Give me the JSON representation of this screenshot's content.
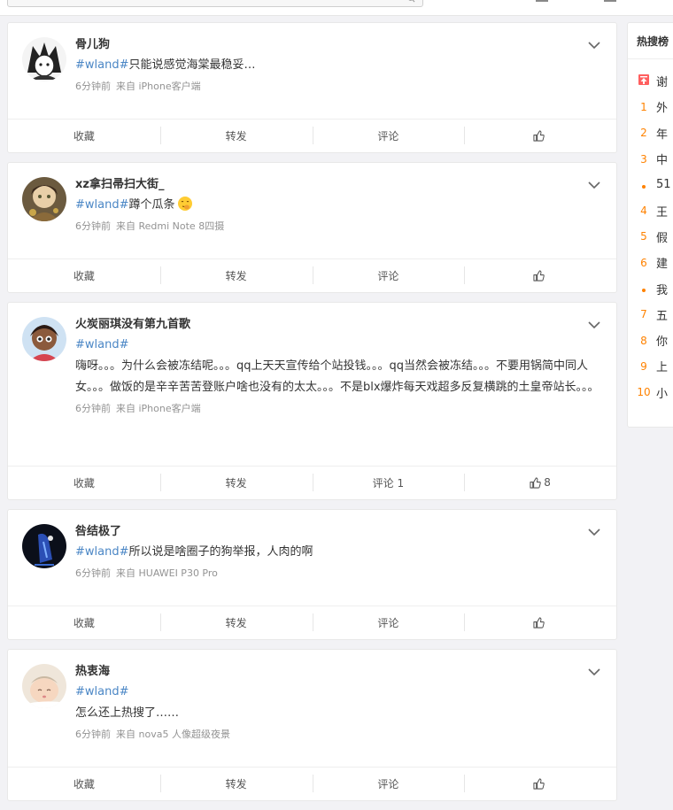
{
  "posts": [
    {
      "username": "骨儿狗",
      "topic": "#wland#",
      "text": "只能说感觉海棠最稳妥…",
      "time": "6分钟前",
      "source": "来自 iPhone客户端",
      "actions": {
        "collect": "收藏",
        "repost": "转发",
        "comment": "评论",
        "like_count": ""
      }
    },
    {
      "username": "xz拿扫帚扫大街_",
      "topic": "#wland#",
      "text": "蹲个瓜条",
      "time": "6分钟前",
      "source": "来自 Redmi Note 8四摄",
      "actions": {
        "collect": "收藏",
        "repost": "转发",
        "comment": "评论",
        "like_count": ""
      }
    },
    {
      "username": "火炭丽琪没有第九首歌",
      "topic": "#wland#",
      "text": "嗨呀。。。为什么会被冻结呢。。。qq上天天宣传给个站投钱。。。qq当然会被冻结。。。不要用锅简中同人女。。。做饭的是辛辛苦苦登账户啥也没有的太太。。。不是blx爆炸每天戏超多反复横跳的土皇帝站长。。。",
      "time": "6分钟前",
      "source": "来自 iPhone客户端",
      "actions": {
        "collect": "收藏",
        "repost": "转发",
        "comment": "评论 1",
        "like_count": "8"
      }
    },
    {
      "username": "咎结极了",
      "topic": "#wland#",
      "text": "所以说是啥圈子的狗举报，人肉的啊",
      "time": "6分钟前",
      "source": "来自 HUAWEI P30 Pro",
      "actions": {
        "collect": "收藏",
        "repost": "转发",
        "comment": "评论",
        "like_count": ""
      }
    },
    {
      "username": "热衷海",
      "topic": "#wland#",
      "text": "怎么还上热搜了……",
      "time": "6分钟前",
      "source": "来自 nova5 人像超级夜景",
      "actions": {
        "collect": "收藏",
        "repost": "转发",
        "comment": "评论",
        "like_count": ""
      }
    }
  ],
  "hot_search": {
    "title": "热搜榜",
    "items": [
      {
        "rank": "",
        "marker": "pin",
        "text": "谢"
      },
      {
        "rank": "1",
        "text": "外"
      },
      {
        "rank": "2",
        "text": "年"
      },
      {
        "rank": "3",
        "text": "中"
      },
      {
        "rank": "",
        "marker": "dot",
        "text": "51"
      },
      {
        "rank": "4",
        "text": "王"
      },
      {
        "rank": "5",
        "text": "假"
      },
      {
        "rank": "6",
        "text": "建"
      },
      {
        "rank": "",
        "marker": "dot",
        "text": "我"
      },
      {
        "rank": "7",
        "text": "五"
      },
      {
        "rank": "8",
        "text": "你"
      },
      {
        "rank": "9",
        "text": "上"
      },
      {
        "rank": "10",
        "text": "小"
      }
    ]
  },
  "colors": {
    "topic": "#4a86c5",
    "rank": "#ff8200",
    "meta": "#939393"
  }
}
